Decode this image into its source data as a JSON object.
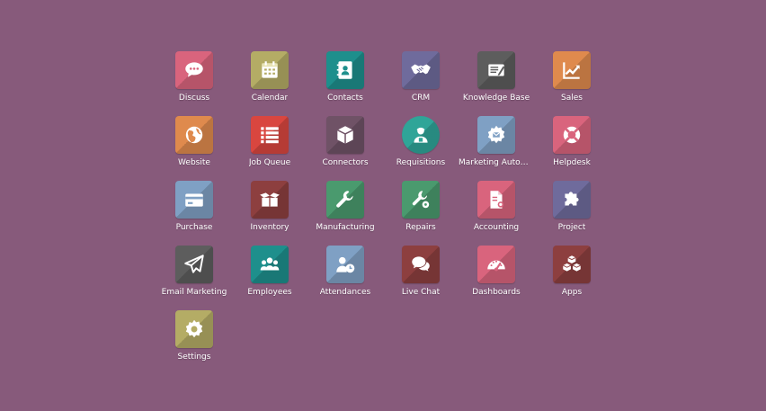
{
  "apps": [
    {
      "label": "Discuss",
      "icon": "discuss-icon",
      "color": "#d9647d"
    },
    {
      "label": "Calendar",
      "icon": "calendar-icon",
      "color": "#b4ac65"
    },
    {
      "label": "Contacts",
      "icon": "contacts-icon",
      "color": "#1e8f8c"
    },
    {
      "label": "CRM",
      "icon": "crm-handshake-icon",
      "color": "#6f6b9c"
    },
    {
      "label": "Knowledge Base",
      "icon": "knowledge-base-icon",
      "color": "#5d5d5d"
    },
    {
      "label": "Sales",
      "icon": "sales-chart-icon",
      "color": "#df8a4d"
    },
    {
      "label": "Website",
      "icon": "globe-icon",
      "color": "#df8a4d"
    },
    {
      "label": "Job Queue",
      "icon": "list-icon",
      "color": "#d9463f"
    },
    {
      "label": "Connectors",
      "icon": "box-icon",
      "color": "#6f5266"
    },
    {
      "label": "Requisitions",
      "icon": "requisition-user-icon",
      "color": "#2fa598"
    },
    {
      "label": "Marketing Automation",
      "icon": "marketing-gear-icon",
      "color": "#7fa0c4"
    },
    {
      "label": "Helpdesk",
      "icon": "lifebuoy-icon",
      "color": "#d9647d"
    },
    {
      "label": "Purchase",
      "icon": "credit-card-icon",
      "color": "#7fa0c4"
    },
    {
      "label": "Inventory",
      "icon": "open-box-icon",
      "color": "#8d3f3f"
    },
    {
      "label": "Manufacturing",
      "icon": "wrench-icon",
      "color": "#4a9a6e"
    },
    {
      "label": "Repairs",
      "icon": "repair-tools-icon",
      "color": "#4a9a6e"
    },
    {
      "label": "Accounting",
      "icon": "accounting-doc-icon",
      "color": "#d9647d"
    },
    {
      "label": "Project",
      "icon": "puzzle-icon",
      "color": "#6f6b9c"
    },
    {
      "label": "Email Marketing",
      "icon": "paper-plane-icon",
      "color": "#5d5d5d"
    },
    {
      "label": "Employees",
      "icon": "employees-icon",
      "color": "#1e8f8c"
    },
    {
      "label": "Attendances",
      "icon": "attendance-clock-icon",
      "color": "#7fa0c4"
    },
    {
      "label": "Live Chat",
      "icon": "chat-bubbles-icon",
      "color": "#8d3f3f"
    },
    {
      "label": "Dashboards",
      "icon": "dashboard-gauge-icon",
      "color": "#d9647d"
    },
    {
      "label": "Apps",
      "icon": "cubes-icon",
      "color": "#8d3f3f"
    },
    {
      "label": "Settings",
      "icon": "settings-gear-icon",
      "color": "#b4ac65"
    }
  ]
}
